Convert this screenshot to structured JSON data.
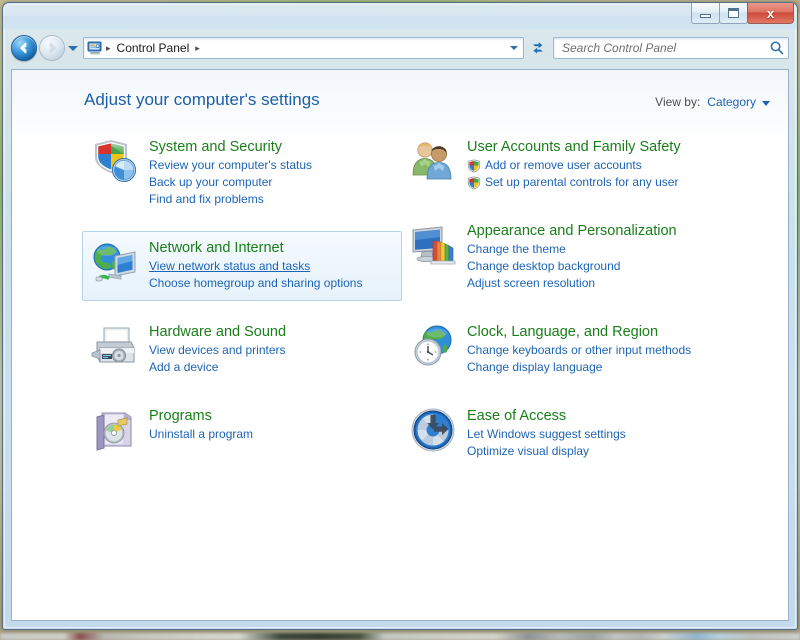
{
  "window": {
    "titlebar": {
      "minimize_label": "Minimize",
      "maximize_label": "Maximize",
      "close_label": "x"
    }
  },
  "navbar": {
    "back_label": "Back",
    "forward_label": "Forward",
    "history_label": "Recent pages",
    "address_icon": "control-panel-icon",
    "breadcrumbs": [
      "Control Panel"
    ],
    "separator": "▸",
    "refresh_label": "Refresh",
    "search": {
      "value": "",
      "placeholder": "Search Control Panel"
    }
  },
  "content": {
    "page_title": "Adjust your computer's settings",
    "viewby": {
      "label": "View by:",
      "value": "Category"
    },
    "columns": [
      {
        "id": "left",
        "categories": [
          {
            "icon": "system-and-security-icon",
            "title": "System and Security",
            "hovered": false,
            "links": [
              {
                "label": "Review your computer's status",
                "shield": false,
                "underlined": false
              },
              {
                "label": "Back up your computer",
                "shield": false,
                "underlined": false
              },
              {
                "label": "Find and fix problems",
                "shield": false,
                "underlined": false
              }
            ]
          },
          {
            "icon": "network-and-internet-icon",
            "title": "Network and Internet",
            "hovered": true,
            "links": [
              {
                "label": "View network status and tasks",
                "shield": false,
                "underlined": true
              },
              {
                "label": "Choose homegroup and sharing options",
                "shield": false,
                "underlined": false
              }
            ]
          },
          {
            "icon": "hardware-and-sound-icon",
            "title": "Hardware and Sound",
            "hovered": false,
            "links": [
              {
                "label": "View devices and printers",
                "shield": false,
                "underlined": false
              },
              {
                "label": "Add a device",
                "shield": false,
                "underlined": false
              }
            ]
          },
          {
            "icon": "programs-icon",
            "title": "Programs",
            "hovered": false,
            "links": [
              {
                "label": "Uninstall a program",
                "shield": false,
                "underlined": false
              }
            ]
          }
        ]
      },
      {
        "id": "right",
        "categories": [
          {
            "icon": "user-accounts-icon",
            "title": "User Accounts and Family Safety",
            "hovered": false,
            "links": [
              {
                "label": "Add or remove user accounts",
                "shield": true,
                "underlined": false
              },
              {
                "label": "Set up parental controls for any user",
                "shield": true,
                "underlined": false
              }
            ]
          },
          {
            "icon": "appearance-icon",
            "title": "Appearance and Personalization",
            "hovered": false,
            "links": [
              {
                "label": "Change the theme",
                "shield": false,
                "underlined": false
              },
              {
                "label": "Change desktop background",
                "shield": false,
                "underlined": false
              },
              {
                "label": "Adjust screen resolution",
                "shield": false,
                "underlined": false
              }
            ]
          },
          {
            "icon": "clock-language-region-icon",
            "title": "Clock, Language, and Region",
            "hovered": false,
            "links": [
              {
                "label": "Change keyboards or other input methods",
                "shield": false,
                "underlined": false
              },
              {
                "label": "Change display language",
                "shield": false,
                "underlined": false
              }
            ]
          },
          {
            "icon": "ease-of-access-icon",
            "title": "Ease of Access",
            "hovered": false,
            "links": [
              {
                "label": "Let Windows suggest settings",
                "shield": false,
                "underlined": false
              },
              {
                "label": "Optimize visual display",
                "shield": false,
                "underlined": false
              }
            ]
          }
        ]
      }
    ]
  },
  "colors": {
    "category_title": "#1a7e1a",
    "link": "#1d64b6",
    "page_title": "#1d5fa8",
    "close_button": "#cd4b3a",
    "hover_border": "#b5d5ee"
  }
}
